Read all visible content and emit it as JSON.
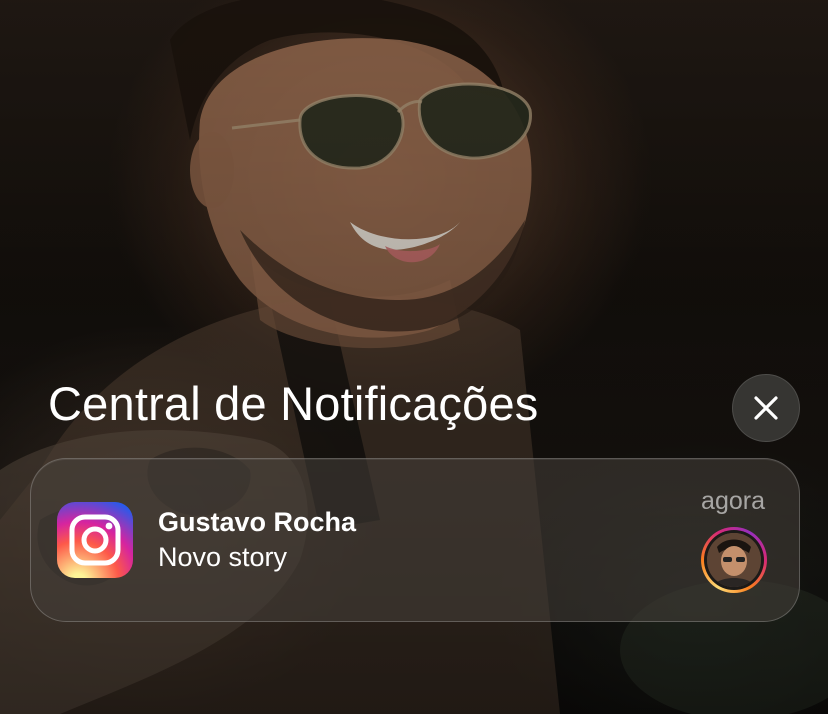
{
  "notification_center": {
    "title": "Central de Notificações",
    "close_icon": "close-icon"
  },
  "notification": {
    "app_icon": "instagram-icon",
    "title": "Gustavo Rocha",
    "body": "Novo story",
    "time": "agora",
    "avatar_icon": "story-avatar"
  },
  "colors": {
    "text_primary": "#ffffff",
    "text_secondary": "#a8a39e",
    "card_background": "#46403a",
    "close_button_background": "#3a3836"
  }
}
